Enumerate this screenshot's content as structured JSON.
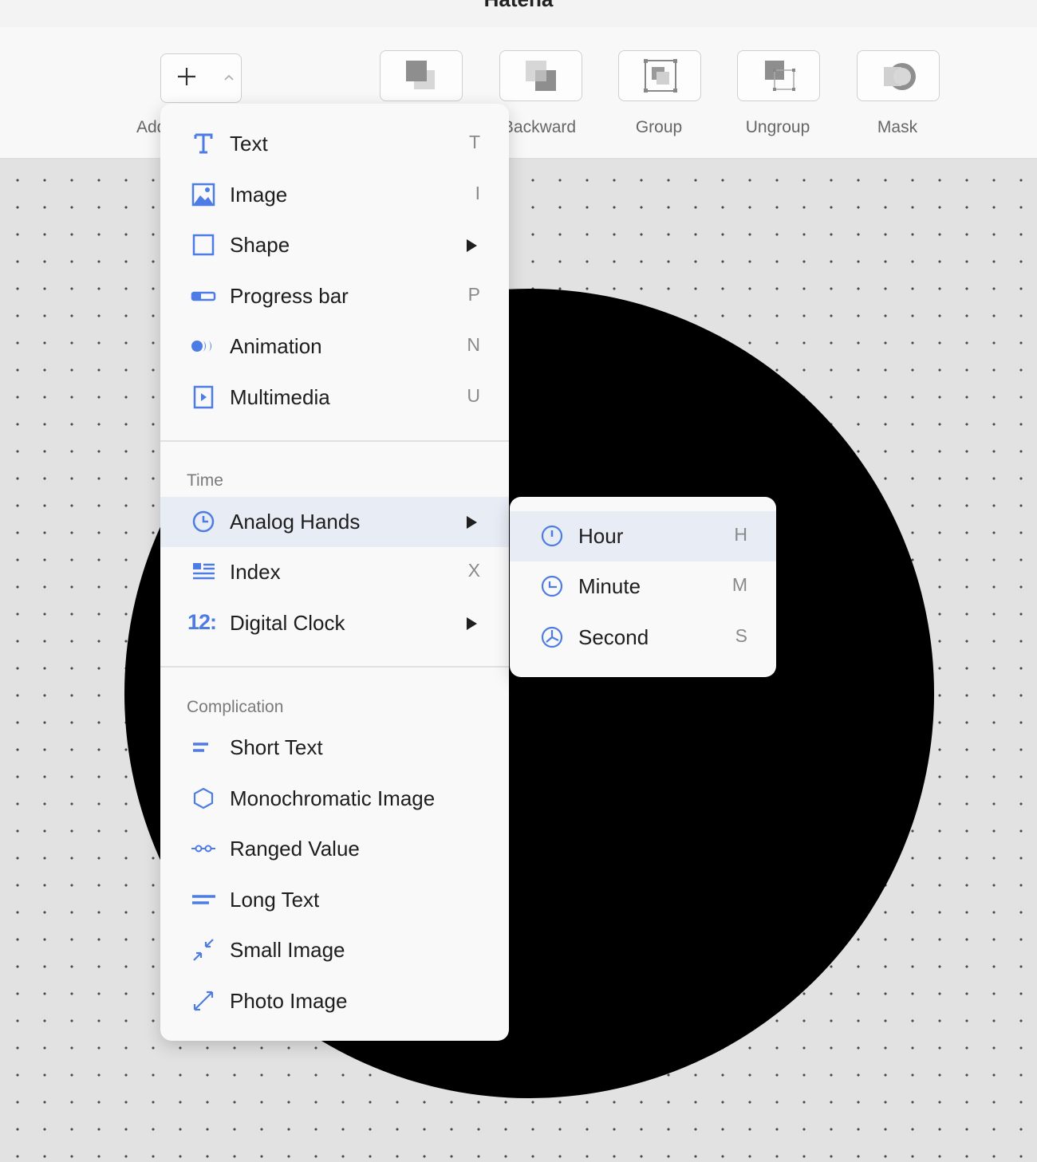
{
  "window": {
    "title": "Hatena"
  },
  "toolbar": {
    "add_label": "Add",
    "buttons": [
      {
        "label": "Backward",
        "icon": "send-backward-icon"
      },
      {
        "label": "Group",
        "icon": "group-icon"
      },
      {
        "label": "Ungroup",
        "icon": "ungroup-icon"
      },
      {
        "label": "Mask",
        "icon": "mask-icon"
      }
    ]
  },
  "add_menu": {
    "items": [
      {
        "label": "Text",
        "shortcut": "T",
        "icon": "text-icon"
      },
      {
        "label": "Image",
        "shortcut": "I",
        "icon": "image-icon"
      },
      {
        "label": "Shape",
        "shortcut": "",
        "icon": "shape-icon",
        "submenu": true
      },
      {
        "label": "Progress bar",
        "shortcut": "P",
        "icon": "progress-bar-icon"
      },
      {
        "label": "Animation",
        "shortcut": "N",
        "icon": "animation-icon"
      },
      {
        "label": "Multimedia",
        "shortcut": "U",
        "icon": "multimedia-icon"
      }
    ],
    "time_section": {
      "title": "Time",
      "items": [
        {
          "label": "Analog Hands",
          "shortcut": "",
          "icon": "clock-icon",
          "submenu": true,
          "active": true
        },
        {
          "label": "Index",
          "shortcut": "X",
          "icon": "index-icon"
        },
        {
          "label": "Digital Clock",
          "shortcut": "",
          "icon": "digital-clock-icon",
          "icon_text": "12:",
          "submenu": true
        }
      ]
    },
    "complication_section": {
      "title": "Complication",
      "items": [
        {
          "label": "Short Text",
          "icon": "short-text-icon"
        },
        {
          "label": "Monochromatic Image",
          "icon": "hexagon-icon"
        },
        {
          "label": "Ranged Value",
          "icon": "ranged-value-icon"
        },
        {
          "label": "Long Text",
          "icon": "long-text-icon"
        },
        {
          "label": "Small Image",
          "icon": "small-image-icon"
        },
        {
          "label": "Photo Image",
          "icon": "photo-image-icon"
        }
      ]
    }
  },
  "analog_hands_submenu": {
    "items": [
      {
        "label": "Hour",
        "shortcut": "H",
        "icon": "hour-hand-icon",
        "active": true
      },
      {
        "label": "Minute",
        "shortcut": "M",
        "icon": "minute-hand-icon"
      },
      {
        "label": "Second",
        "shortcut": "S",
        "icon": "second-hand-icon"
      }
    ]
  },
  "colors": {
    "accent": "#4c7ce4",
    "menu_bg": "#f9f9f9",
    "active_row": "#e8ecf5",
    "watchface": "#000000"
  }
}
